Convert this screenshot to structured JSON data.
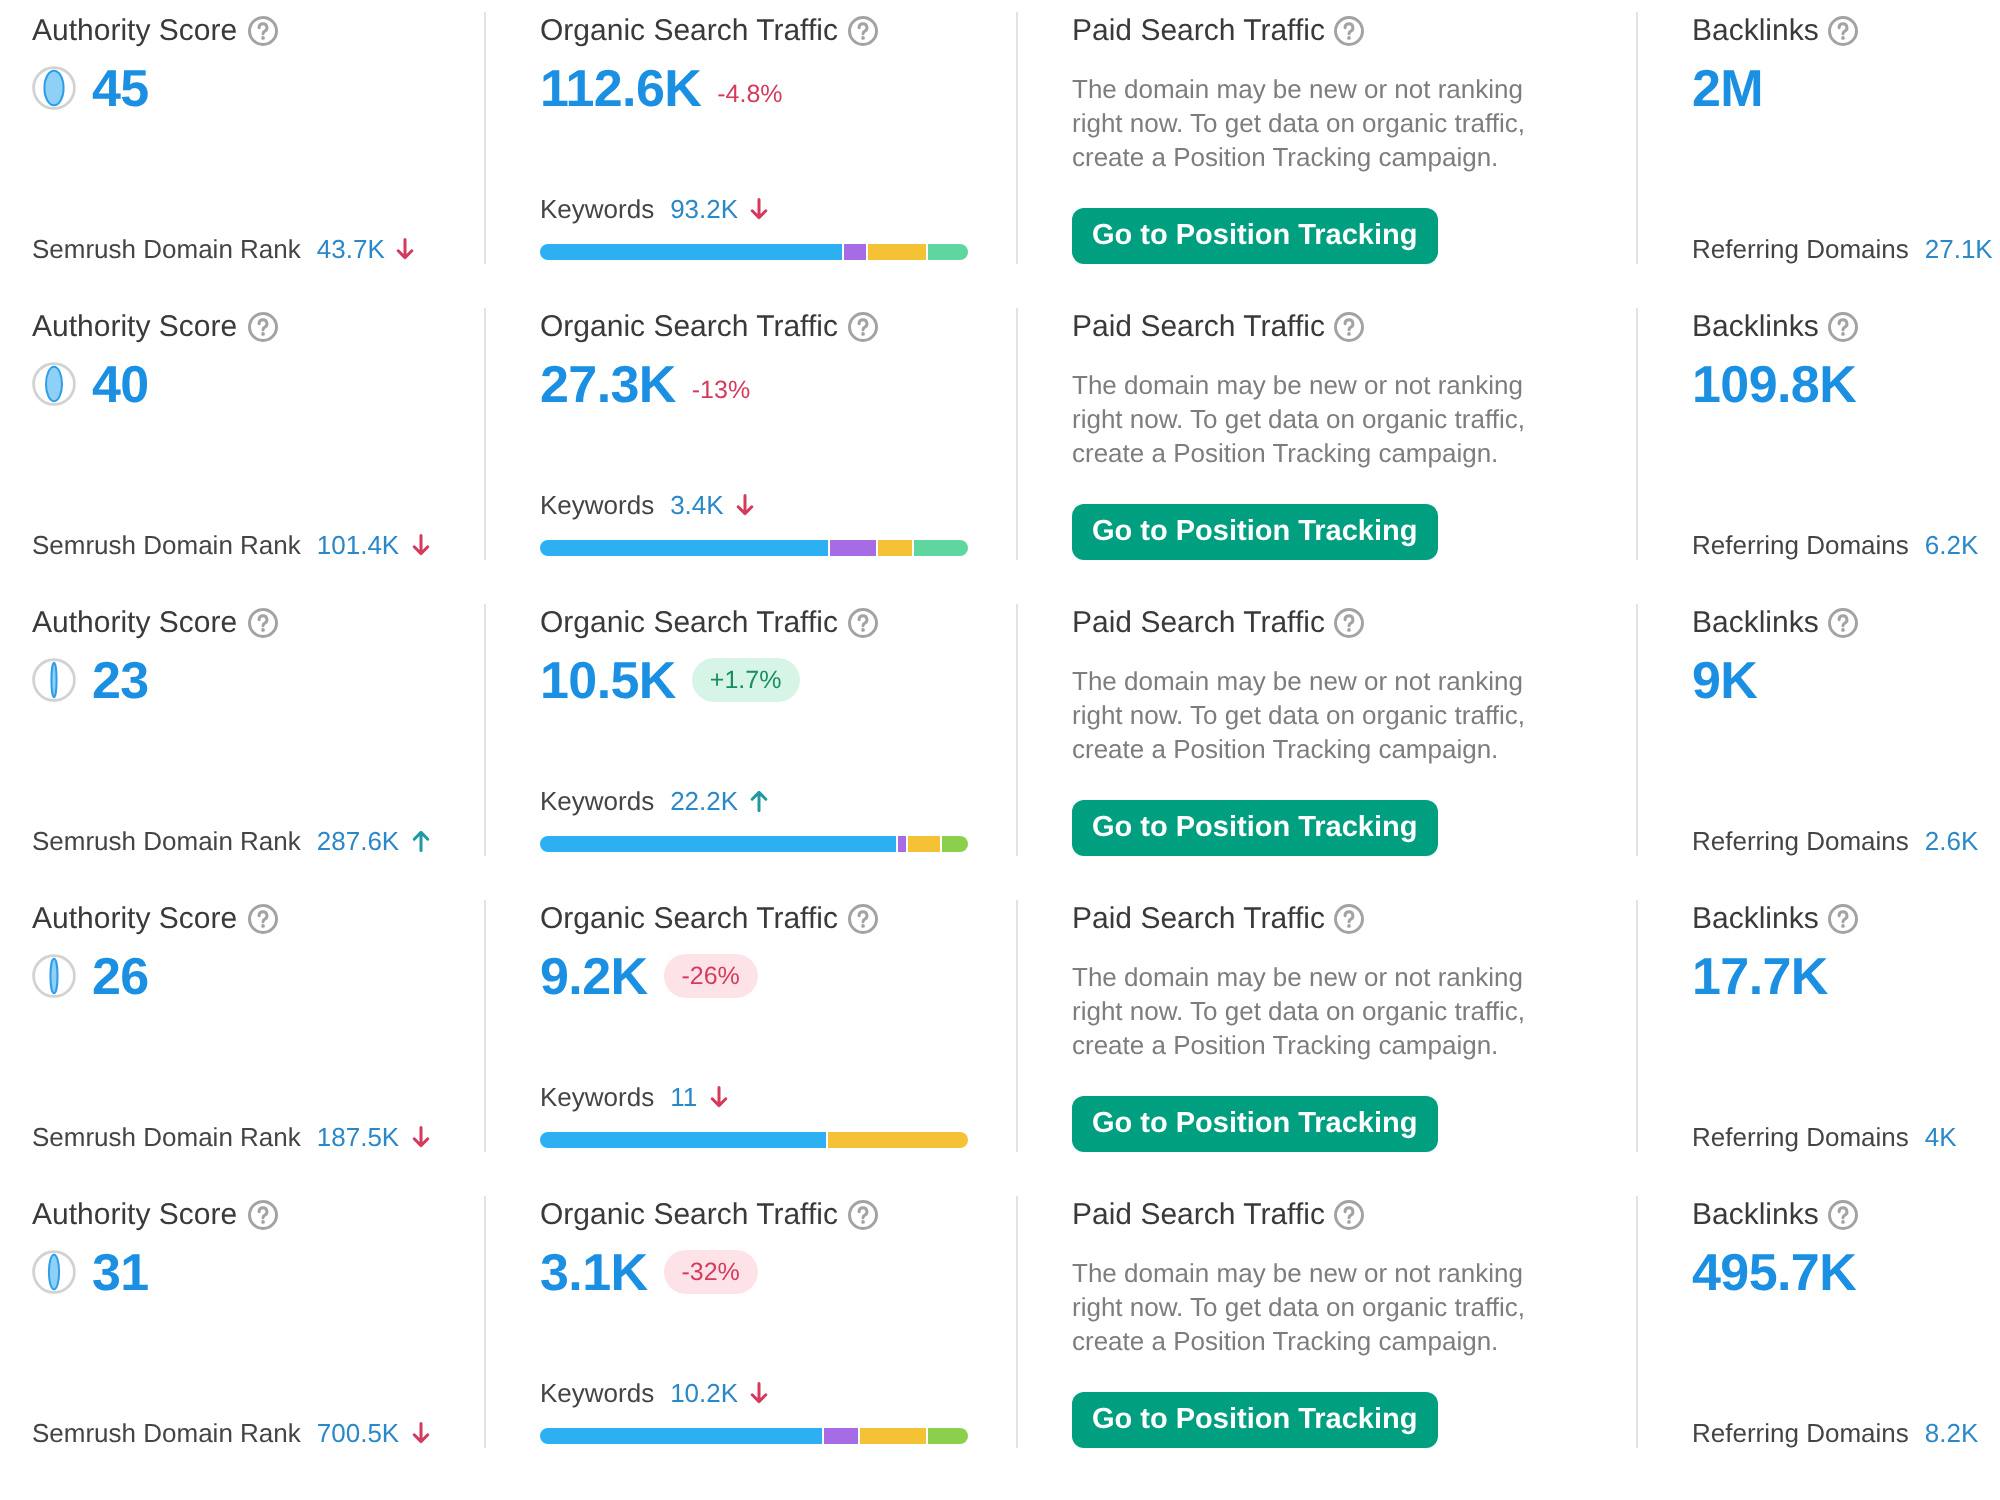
{
  "rows": [
    {
      "authority": {
        "title": "Authority Score",
        "score": "45",
        "rank_label": "Semrush Domain Rank",
        "rank": "43.7K",
        "rank_rising": false
      },
      "organic": {
        "title": "Organic Search Traffic",
        "value": "112.6K",
        "change": "-4.8%",
        "change_rising": false,
        "change_badge": false,
        "keywords_label": "Keywords",
        "keywords": "93.2K",
        "keywords_rising": false
      },
      "paid": {
        "title": "Paid Search Traffic",
        "message": "The domain may be new or not ranking right now. To get data on organic traffic, create a Position Tracking campaign.",
        "button": "Go to Position Tracking"
      },
      "backlinks": {
        "title": "Backlinks",
        "value": "2M",
        "domains_label": "Referring Domains",
        "domains": "27.1K"
      }
    },
    {
      "authority": {
        "title": "Authority Score",
        "score": "40",
        "rank_label": "Semrush Domain Rank",
        "rank": "101.4K",
        "rank_rising": false
      },
      "organic": {
        "title": "Organic Search Traffic",
        "value": "27.3K",
        "change": "-13%",
        "change_rising": false,
        "change_badge": false,
        "keywords_label": "Keywords",
        "keywords": "3.4K",
        "keywords_rising": false
      },
      "paid": {
        "title": "Paid Search Traffic",
        "message": "The domain may be new or not ranking right now. To get data on organic traffic, create a Position Tracking campaign.",
        "button": "Go to Position Tracking"
      },
      "backlinks": {
        "title": "Backlinks",
        "value": "109.8K",
        "domains_label": "Referring Domains",
        "domains": "6.2K"
      }
    },
    {
      "authority": {
        "title": "Authority Score",
        "score": "23",
        "rank_label": "Semrush Domain Rank",
        "rank": "287.6K",
        "rank_rising": true
      },
      "organic": {
        "title": "Organic Search Traffic",
        "value": "10.5K",
        "change": "+1.7%",
        "change_rising": true,
        "change_badge": true,
        "keywords_label": "Keywords",
        "keywords": "22.2K",
        "keywords_rising": true
      },
      "paid": {
        "title": "Paid Search Traffic",
        "message": "The domain may be new or not ranking right now. To get data on organic traffic, create a Position Tracking campaign.",
        "button": "Go to Position Tracking"
      },
      "backlinks": {
        "title": "Backlinks",
        "value": "9K",
        "domains_label": "Referring Domains",
        "domains": "2.6K"
      }
    },
    {
      "authority": {
        "title": "Authority Score",
        "score": "26",
        "rank_label": "Semrush Domain Rank",
        "rank": "187.5K",
        "rank_rising": false
      },
      "organic": {
        "title": "Organic Search Traffic",
        "value": "9.2K",
        "change": "-26%",
        "change_rising": false,
        "change_badge": true,
        "keywords_label": "Keywords",
        "keywords": "11",
        "keywords_rising": false
      },
      "paid": {
        "title": "Paid Search Traffic",
        "message": "The domain may be new or not ranking right now. To get data on organic traffic, create a Position Tracking campaign.",
        "button": "Go to Position Tracking"
      },
      "backlinks": {
        "title": "Backlinks",
        "value": "17.7K",
        "domains_label": "Referring Domains",
        "domains": "4K"
      }
    },
    {
      "authority": {
        "title": "Authority Score",
        "score": "31",
        "rank_label": "Semrush Domain Rank",
        "rank": "700.5K",
        "rank_rising": false
      },
      "organic": {
        "title": "Organic Search Traffic",
        "value": "3.1K",
        "change": "-32%",
        "change_rising": false,
        "change_badge": true,
        "keywords_label": "Keywords",
        "keywords": "10.2K",
        "keywords_rising": false
      },
      "paid": {
        "title": "Paid Search Traffic",
        "message": "The domain may be new or not ranking right now. To get data on organic traffic, create a Position Tracking campaign.",
        "button": "Go to Position Tracking"
      },
      "backlinks": {
        "title": "Backlinks",
        "value": "495.7K",
        "domains_label": "Referring Domains",
        "domains": "8.2K"
      }
    }
  ]
}
